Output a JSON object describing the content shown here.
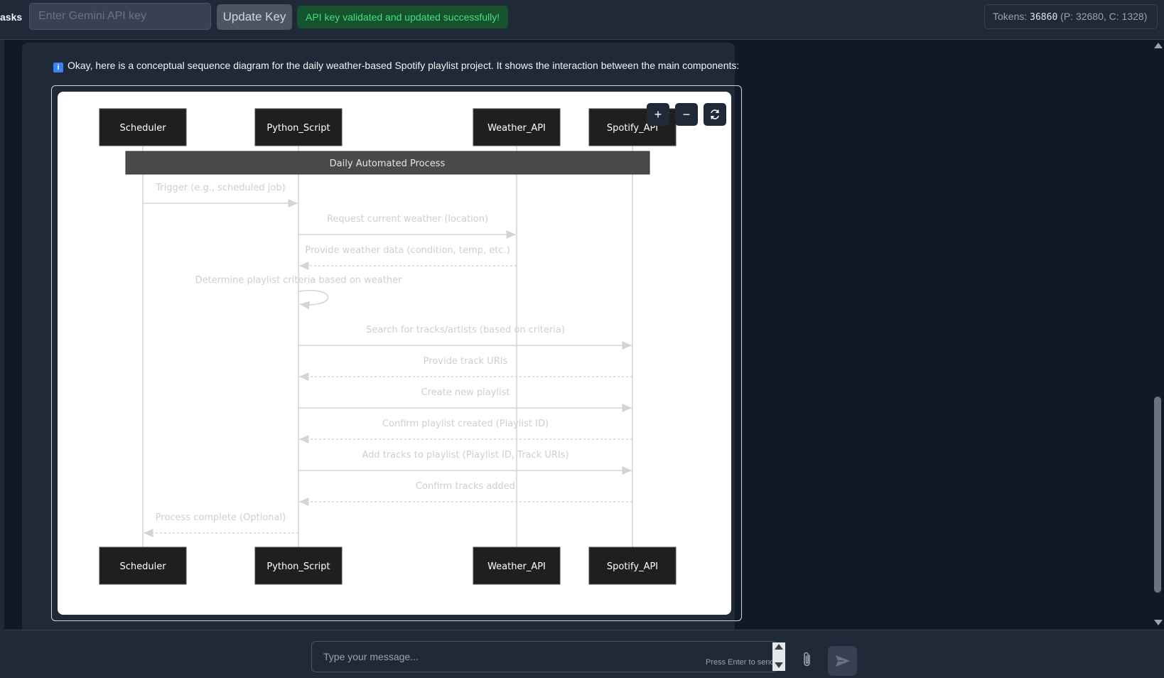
{
  "header": {
    "tasks_label": "asks",
    "api_key_placeholder": "Enter Gemini API key",
    "update_key_label": "Update Key",
    "status_message": "API key validated and updated successfully!",
    "tokens_label": "Tokens:",
    "tokens_total": "36860",
    "tokens_breakdown": "(P: 32680, C: 1328)"
  },
  "message": {
    "icon": "info-icon",
    "text": "Okay, here is a conceptual sequence diagram for the daily weather-based Spotify playlist project. It shows the interaction between the main components:"
  },
  "diagram": {
    "participants": [
      "Scheduler",
      "Python_Script",
      "Weather_API",
      "Spotify_API"
    ],
    "loop_label": "Daily Automated Process",
    "messages": [
      {
        "from": "Scheduler",
        "to": "Python_Script",
        "label": "Trigger (e.g., scheduled job)",
        "style": "solid"
      },
      {
        "from": "Python_Script",
        "to": "Weather_API",
        "label": "Request current weather (location)",
        "style": "solid"
      },
      {
        "from": "Weather_API",
        "to": "Python_Script",
        "label": "Provide weather data (condition, temp, etc.)",
        "style": "dashed"
      },
      {
        "from": "Python_Script",
        "to": "Python_Script",
        "label": "Determine playlist criteria based on weather",
        "style": "self"
      },
      {
        "from": "Python_Script",
        "to": "Spotify_API",
        "label": "Search for tracks/artists (based on criteria)",
        "style": "solid"
      },
      {
        "from": "Spotify_API",
        "to": "Python_Script",
        "label": "Provide track URIs",
        "style": "dashed"
      },
      {
        "from": "Python_Script",
        "to": "Spotify_API",
        "label": "Create new playlist",
        "style": "solid"
      },
      {
        "from": "Spotify_API",
        "to": "Python_Script",
        "label": "Confirm playlist created (Playlist ID)",
        "style": "dashed"
      },
      {
        "from": "Python_Script",
        "to": "Spotify_API",
        "label": "Add tracks to playlist (Playlist ID, Track URIs)",
        "style": "solid"
      },
      {
        "from": "Spotify_API",
        "to": "Python_Script",
        "label": "Confirm tracks added",
        "style": "dashed"
      },
      {
        "from": "Python_Script",
        "to": "Scheduler",
        "label": "Process complete (Optional)",
        "style": "dashed"
      }
    ],
    "controls": {
      "zoom_in": "+",
      "zoom_out": "−",
      "reset_icon": "refresh-icon"
    }
  },
  "composer": {
    "placeholder": "Type your message...",
    "hint": "Press Enter to send",
    "attach_icon": "paperclip-icon",
    "send_icon": "send-icon"
  }
}
